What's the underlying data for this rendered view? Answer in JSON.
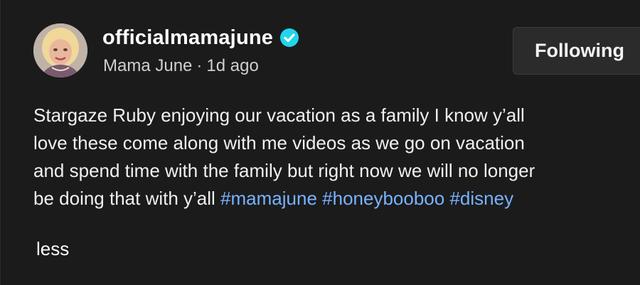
{
  "post": {
    "author": {
      "username": "officialmamajune",
      "display_name": "Mama June",
      "separator": "·",
      "time_ago": "1d ago",
      "verified_icon": "verified-badge-icon",
      "avatar_icon": "avatar"
    },
    "follow_button": {
      "label": "Following"
    },
    "caption": {
      "lines": [
        "Stargaze Ruby enjoying our vacation as a family I know y’all",
        "love these come along with me videos as we go on vacation",
        "and spend time with the family but right now we will no longer",
        "be doing that with y’all"
      ],
      "hashtags": [
        "#mamajune",
        "#honeybooboo",
        "#disney"
      ]
    },
    "less_label": "less"
  },
  "colors": {
    "background": "#1b1b1c",
    "verified": "#20d5ec",
    "hashtag": "#78b3ff",
    "button_bg": "#2b2b2b"
  }
}
